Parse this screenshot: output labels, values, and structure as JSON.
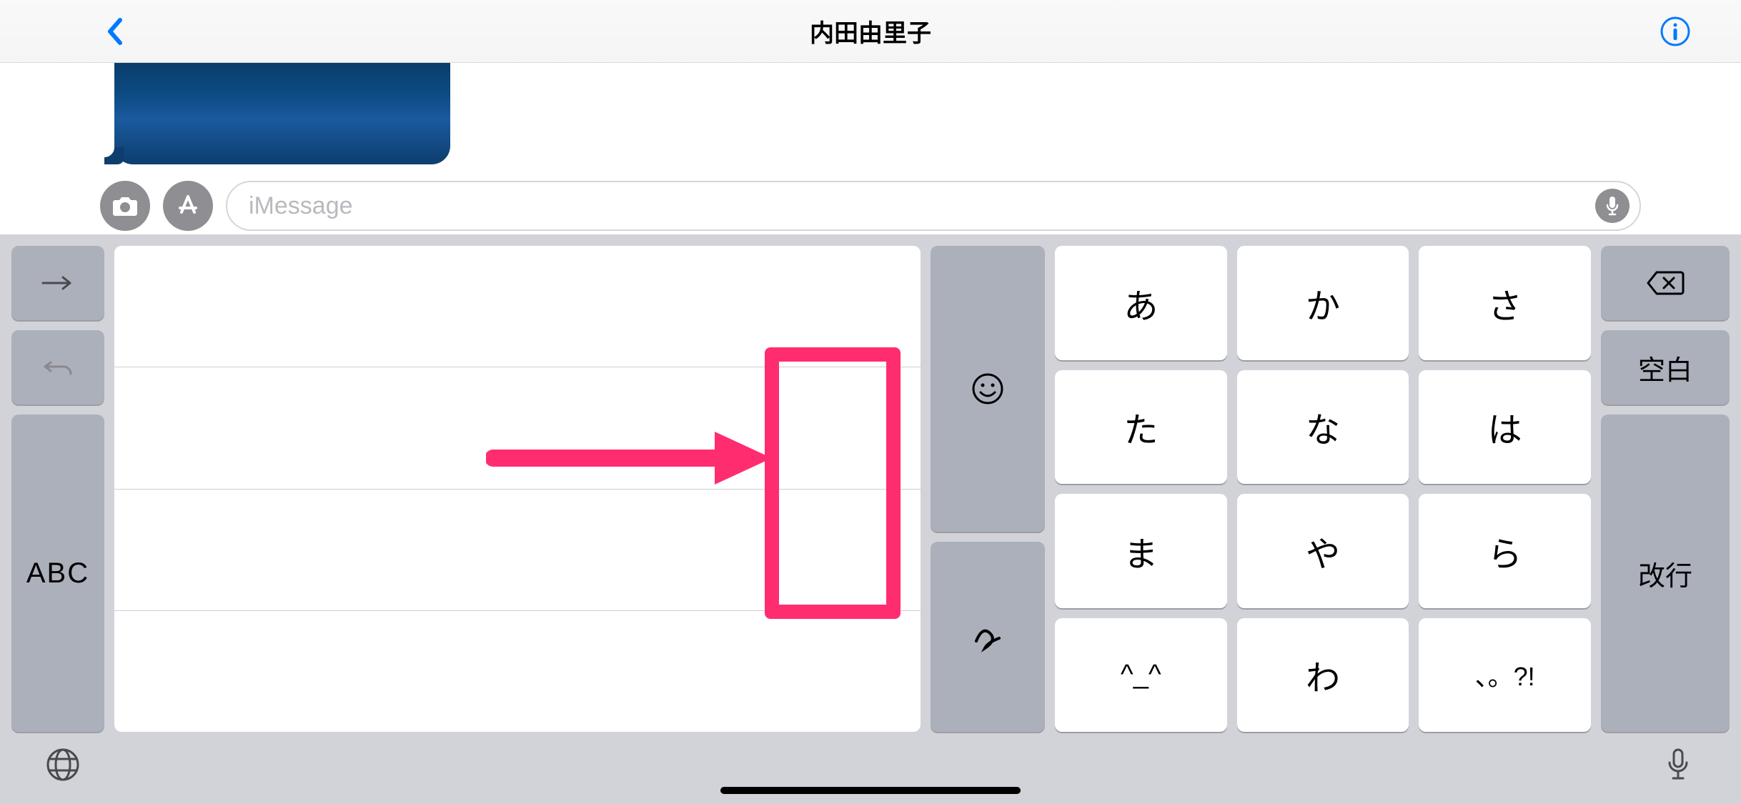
{
  "header": {
    "title": "内田由里子"
  },
  "input": {
    "placeholder": "iMessage"
  },
  "keyboard": {
    "abc_label": "ABC",
    "kana": [
      [
        "あ",
        "か",
        "さ"
      ],
      [
        "た",
        "な",
        "は"
      ],
      [
        "ま",
        "や",
        "ら"
      ],
      [
        "^_^",
        "わ",
        "、。?!"
      ]
    ],
    "func": {
      "delete": "⌫",
      "space": "空白",
      "return": "改行"
    },
    "bottom_row_kana_1": "^_^",
    "bottom_row_kana_2": "わ",
    "bottom_row_kana_3": "、。?!"
  }
}
